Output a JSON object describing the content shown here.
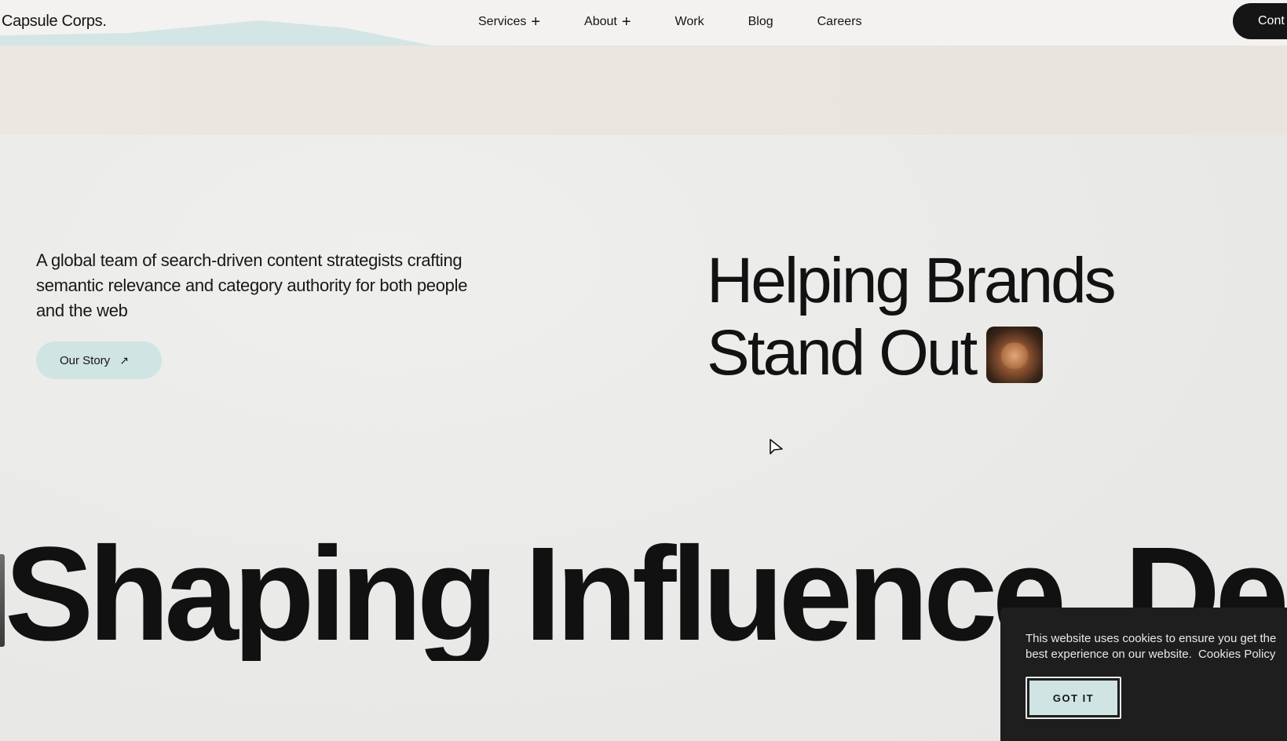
{
  "header": {
    "logo": "Capsule Corps.",
    "nav": [
      {
        "label": "Services",
        "has_plus": true
      },
      {
        "label": "About",
        "has_plus": true
      },
      {
        "label": "Work",
        "has_plus": false
      },
      {
        "label": "Blog",
        "has_plus": false
      },
      {
        "label": "Careers",
        "has_plus": false
      }
    ],
    "plus_icon": "+",
    "contact_label": "Cont"
  },
  "hero": {
    "intro": "A global team of search-driven content strategists crafting semantic relevance and category authority for both people and the web",
    "story_button": "Our Story",
    "story_arrow": "↗",
    "headline_line1": "Helping Brands",
    "headline_line2": "Stand Out",
    "thumb_icon": "team-hands-photo"
  },
  "marquee": {
    "text": "Shaping Influence, Des"
  },
  "cookie": {
    "text": "This website uses cookies to ensure you get the best experience on our website.",
    "policy_link": "Cookies Policy",
    "button": "GOT IT"
  },
  "colors": {
    "accent": "#cfe4e3",
    "dark": "#151515",
    "background": "#ecebe9"
  }
}
